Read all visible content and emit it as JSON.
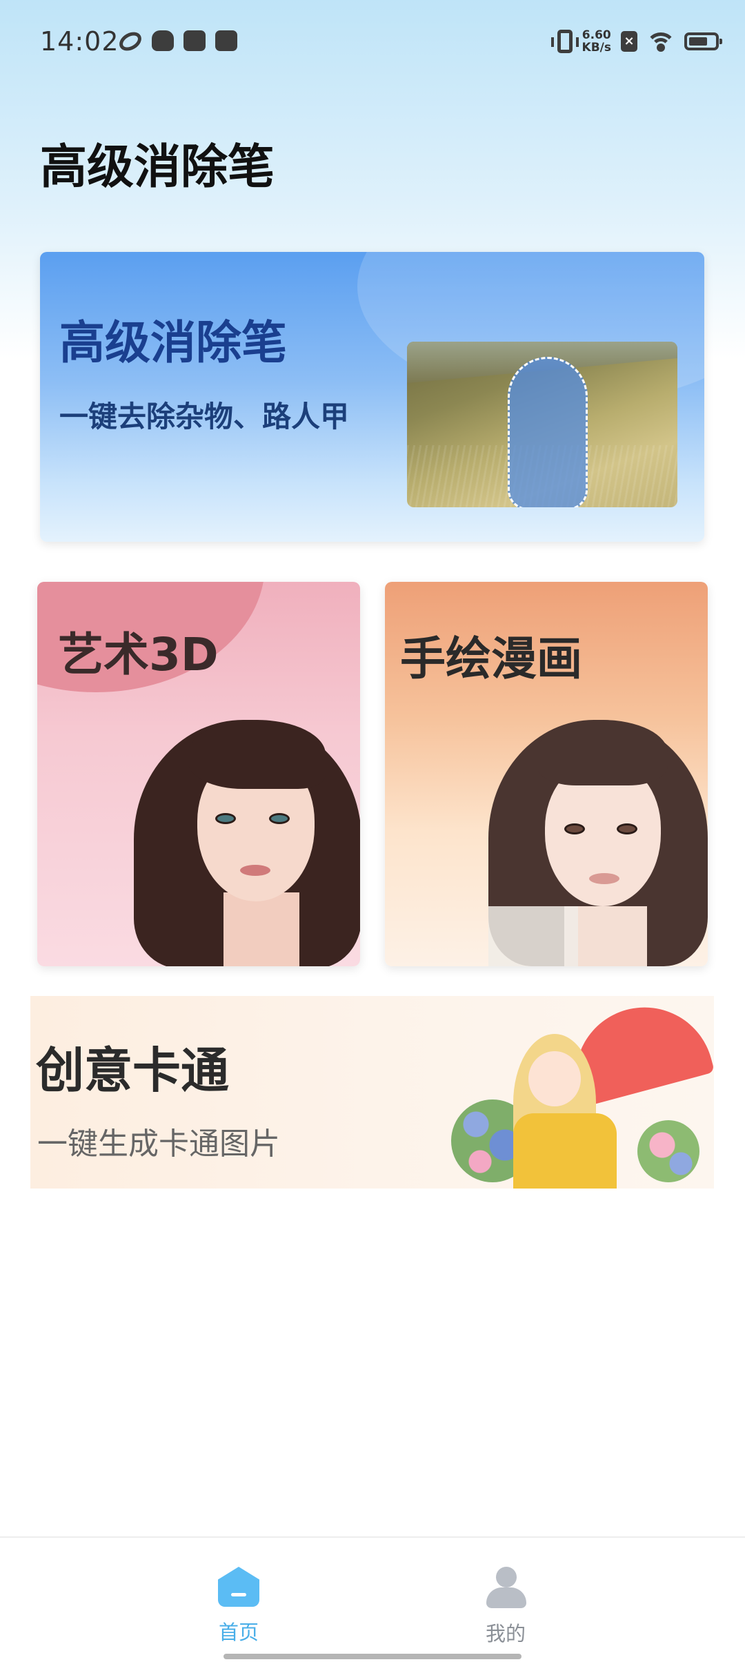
{
  "status_bar": {
    "time": "14:02",
    "left_icons": [
      "swirl-app-icon",
      "cat-app-icon",
      "bag-app-icon",
      "mail-app-icon"
    ],
    "net_speed_value": "6.60",
    "net_speed_unit": "KB/s",
    "sim_icon_glyph": "×",
    "icons": [
      "vibrate-icon",
      "sim-none-icon",
      "wifi-icon",
      "battery-icon"
    ]
  },
  "header": {
    "title": "高级消除笔"
  },
  "cards": {
    "eraser": {
      "title": "高级消除笔",
      "subtitle": "一键去除杂物、路人甲"
    },
    "art3d": {
      "title": "艺术3D"
    },
    "sketch": {
      "title": "手绘漫画"
    },
    "cartoon": {
      "title": "创意卡通",
      "subtitle": "一键生成卡通图片"
    }
  },
  "bottom_nav": {
    "items": [
      {
        "label": "首页",
        "icon": "home-icon",
        "active": true
      },
      {
        "label": "我的",
        "icon": "profile-icon",
        "active": false
      }
    ]
  },
  "colors": {
    "accent": "#5bbcf4",
    "eraser_card_top": "#5b9ff0",
    "art_card_blob": "#e58f9c",
    "sketch_card_top": "#eea077"
  }
}
